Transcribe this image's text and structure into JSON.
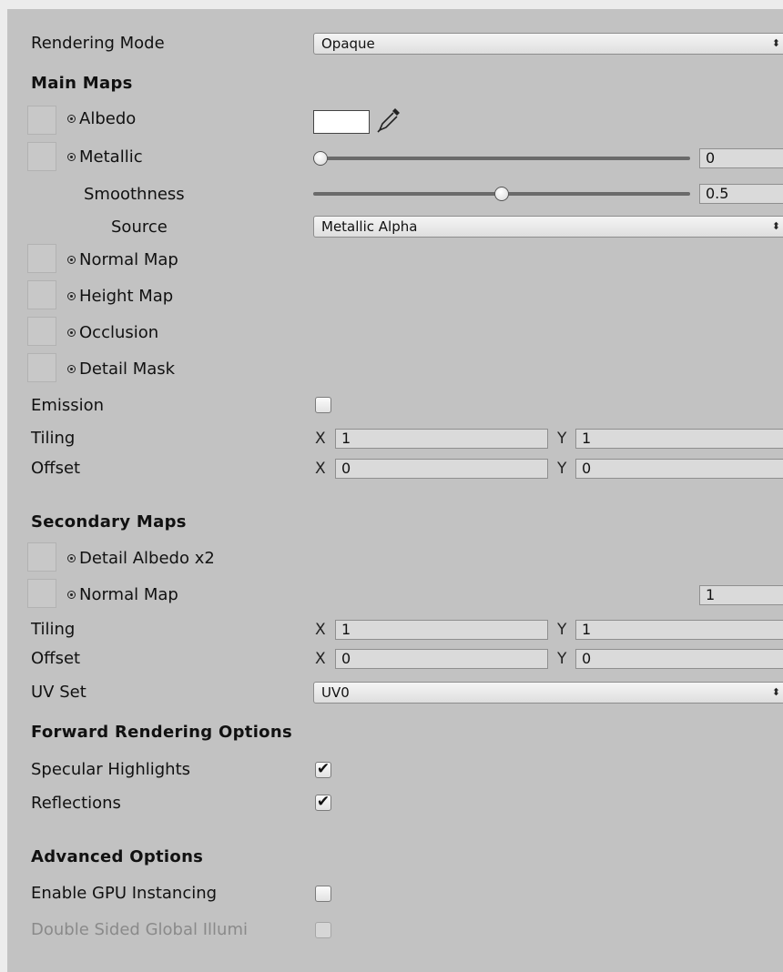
{
  "rendering_mode": {
    "label": "Rendering Mode",
    "value": "Opaque"
  },
  "main_maps": {
    "header": "Main Maps",
    "albedo": {
      "label": "Albedo",
      "color": "#ffffff"
    },
    "metallic": {
      "label": "Metallic",
      "value": "0",
      "slider_fraction": 0.0
    },
    "smoothness": {
      "label": "Smoothness",
      "value": "0.5",
      "slider_fraction": 0.5
    },
    "source": {
      "label": "Source",
      "value": "Metallic Alpha"
    },
    "normal_map": {
      "label": "Normal Map"
    },
    "height_map": {
      "label": "Height Map"
    },
    "occlusion": {
      "label": "Occlusion"
    },
    "detail_mask": {
      "label": "Detail Mask"
    },
    "emission": {
      "label": "Emission",
      "checked": false
    },
    "tiling": {
      "label": "Tiling",
      "x_label": "X",
      "x": "1",
      "y_label": "Y",
      "y": "1"
    },
    "offset": {
      "label": "Offset",
      "x_label": "X",
      "x": "0",
      "y_label": "Y",
      "y": "0"
    }
  },
  "secondary_maps": {
    "header": "Secondary Maps",
    "detail_albedo": {
      "label": "Detail Albedo x2"
    },
    "normal_map": {
      "label": "Normal Map",
      "value": "1"
    },
    "tiling": {
      "label": "Tiling",
      "x_label": "X",
      "x": "1",
      "y_label": "Y",
      "y": "1"
    },
    "offset": {
      "label": "Offset",
      "x_label": "X",
      "x": "0",
      "y_label": "Y",
      "y": "0"
    },
    "uv_set": {
      "label": "UV Set",
      "value": "UV0"
    }
  },
  "forward_rendering": {
    "header": "Forward Rendering Options",
    "specular": {
      "label": "Specular Highlights",
      "checked": true
    },
    "reflections": {
      "label": "Reflections",
      "checked": true
    }
  },
  "advanced": {
    "header": "Advanced Options",
    "gpu_instancing": {
      "label": "Enable GPU Instancing",
      "checked": false
    },
    "double_sided": {
      "label": "Double Sided Global Illumi",
      "checked": false
    }
  },
  "glyphs": {
    "dropdown_arrow": "⬍",
    "check": "✔",
    "eyedropper_icon": "eyedropper-icon",
    "object_picker_icon": "object-picker-icon"
  }
}
